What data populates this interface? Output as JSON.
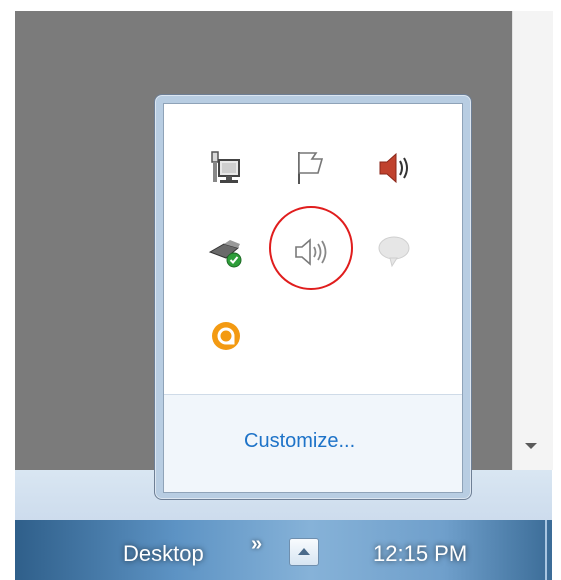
{
  "taskbar": {
    "desktop_label": "Desktop",
    "chevron": "»",
    "clock": "12:15 PM",
    "tray_button_icon": "show-hidden-icons-arrow"
  },
  "tray_popup": {
    "icons": [
      {
        "name": "network-icon"
      },
      {
        "name": "action-center-flag-icon"
      },
      {
        "name": "volume-red-icon"
      },
      {
        "name": "usb-safely-remove-icon"
      },
      {
        "name": "volume-speaker-icon",
        "highlighted": true
      },
      {
        "name": "speech-bubble-icon"
      },
      {
        "name": "orange-app-icon"
      }
    ],
    "customize_label": "Customize..."
  },
  "colors": {
    "highlight_circle": "#e01d1d",
    "link": "#1e73c8"
  }
}
